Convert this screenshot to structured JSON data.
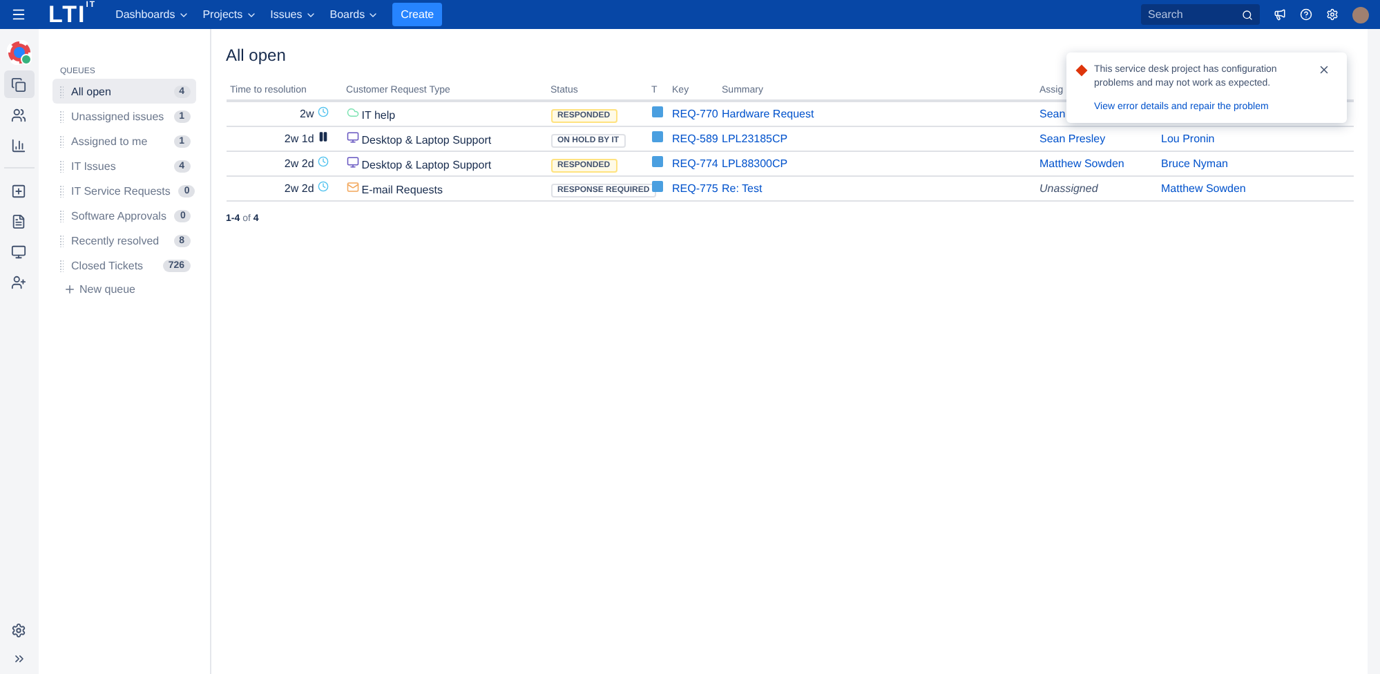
{
  "topbar": {
    "logo": "LTI",
    "logo_sup": "IT",
    "menus": [
      "Dashboards",
      "Projects",
      "Issues",
      "Boards"
    ],
    "create": "Create",
    "search": {
      "placeholder": "Search"
    }
  },
  "rail": {
    "items": [
      {
        "selected": true
      },
      {
        "selected": false
      },
      {
        "selected": false
      },
      {
        "selected": false
      },
      {
        "selected": false
      },
      {
        "selected": false
      },
      {
        "selected": false
      }
    ]
  },
  "sidebar": {
    "heading": "QUEUES",
    "queues": [
      {
        "label": "All open",
        "count": "4",
        "selected": true
      },
      {
        "label": "Unassigned issues",
        "count": "1",
        "selected": false
      },
      {
        "label": "Assigned to me",
        "count": "1",
        "selected": false
      },
      {
        "label": "IT Issues",
        "count": "4",
        "selected": false
      },
      {
        "label": "IT Service Requests",
        "count": "0",
        "selected": false
      },
      {
        "label": "Software Approvals",
        "count": "0",
        "selected": false
      },
      {
        "label": "Recently resolved",
        "count": "8",
        "selected": false
      },
      {
        "label": "Closed Tickets",
        "count": "726",
        "selected": false
      }
    ],
    "new_queue": "New queue"
  },
  "page": {
    "title": "All open",
    "columns": [
      "Time to resolution",
      "Customer Request Type",
      "Status",
      "T",
      "Key",
      "Summary",
      "Assig"
    ],
    "rows": [
      {
        "time": "2w",
        "paused": false,
        "type": {
          "label": "IT help",
          "kind": "help"
        },
        "status": {
          "label": "RESPONDED",
          "kind": "responded"
        },
        "key": "REQ-770",
        "summary": "Hardware Request",
        "assignee": "Sean",
        "unassigned": false
      },
      {
        "time": "2w 1d",
        "paused": true,
        "type": {
          "label": "Desktop & Laptop Support",
          "kind": "desktop"
        },
        "status": {
          "label": "ON HOLD BY IT",
          "kind": "hold"
        },
        "key": "REQ-589",
        "summary": "LPL23185CP",
        "assignee": "Sean Presley",
        "unassigned": false,
        "reporter": "Lou Pronin"
      },
      {
        "time": "2w 2d",
        "paused": false,
        "type": {
          "label": "Desktop & Laptop Support",
          "kind": "desktop"
        },
        "status": {
          "label": "RESPONDED",
          "kind": "responded"
        },
        "key": "REQ-774",
        "summary": "LPL88300CP",
        "assignee": "Matthew Sowden",
        "unassigned": false,
        "reporter": "Bruce Nyman"
      },
      {
        "time": "2w 2d",
        "paused": false,
        "type": {
          "label": "E-mail Requests",
          "kind": "email"
        },
        "status": {
          "label": "RESPONSE REQUIRED",
          "kind": "required"
        },
        "key": "REQ-775",
        "summary": "Re: Test",
        "assignee": "Unassigned",
        "unassigned": true,
        "reporter": "Matthew Sowden"
      }
    ],
    "pager": {
      "range": "1-4",
      "of": "of",
      "total": "4"
    }
  },
  "toast": {
    "message": "This service desk project has configuration problems and may not work as expected.",
    "link": "View error details and repair the problem"
  }
}
